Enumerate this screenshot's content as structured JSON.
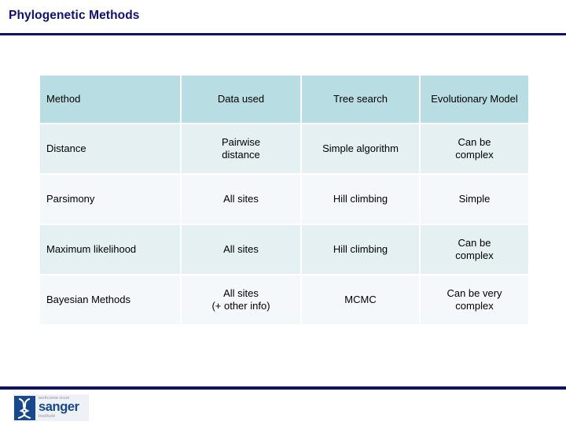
{
  "slide": {
    "title": "Phylogenetic Methods"
  },
  "table": {
    "headers": [
      {
        "label": "Method",
        "align": "left"
      },
      {
        "label": "Data used",
        "align": "center"
      },
      {
        "label": "Tree search",
        "align": "center"
      },
      {
        "label": "Evolutionary Model",
        "align": "center"
      }
    ],
    "rows": [
      {
        "method": "Distance",
        "data_used": [
          "Pairwise",
          "distance"
        ],
        "tree_search": [
          "Simple algorithm"
        ],
        "evolutionary_model": [
          "Can be",
          "complex"
        ]
      },
      {
        "method": "Parsimony",
        "data_used": [
          "All sites"
        ],
        "tree_search": [
          "Hill climbing"
        ],
        "evolutionary_model": [
          "Simple"
        ]
      },
      {
        "method": "Maximum likelihood",
        "data_used": [
          "All sites"
        ],
        "tree_search": [
          "Hill climbing"
        ],
        "evolutionary_model": [
          "Can be",
          "complex"
        ]
      },
      {
        "method": "Bayesian Methods",
        "data_used": [
          "All sites",
          "(+ other info)"
        ],
        "tree_search": [
          "MCMC"
        ],
        "evolutionary_model": [
          "Can be very",
          "complex"
        ]
      }
    ]
  },
  "footer": {
    "logo": {
      "top_text": "wellcome trust",
      "main_text": "sanger",
      "bottom_text": "institute"
    }
  },
  "colors": {
    "navy": "#10106e",
    "header_fill": "#b8dde2",
    "row_shade": "#e4f0f2",
    "row_plain": "#f5f8fb",
    "logo_blue": "#17478c"
  }
}
